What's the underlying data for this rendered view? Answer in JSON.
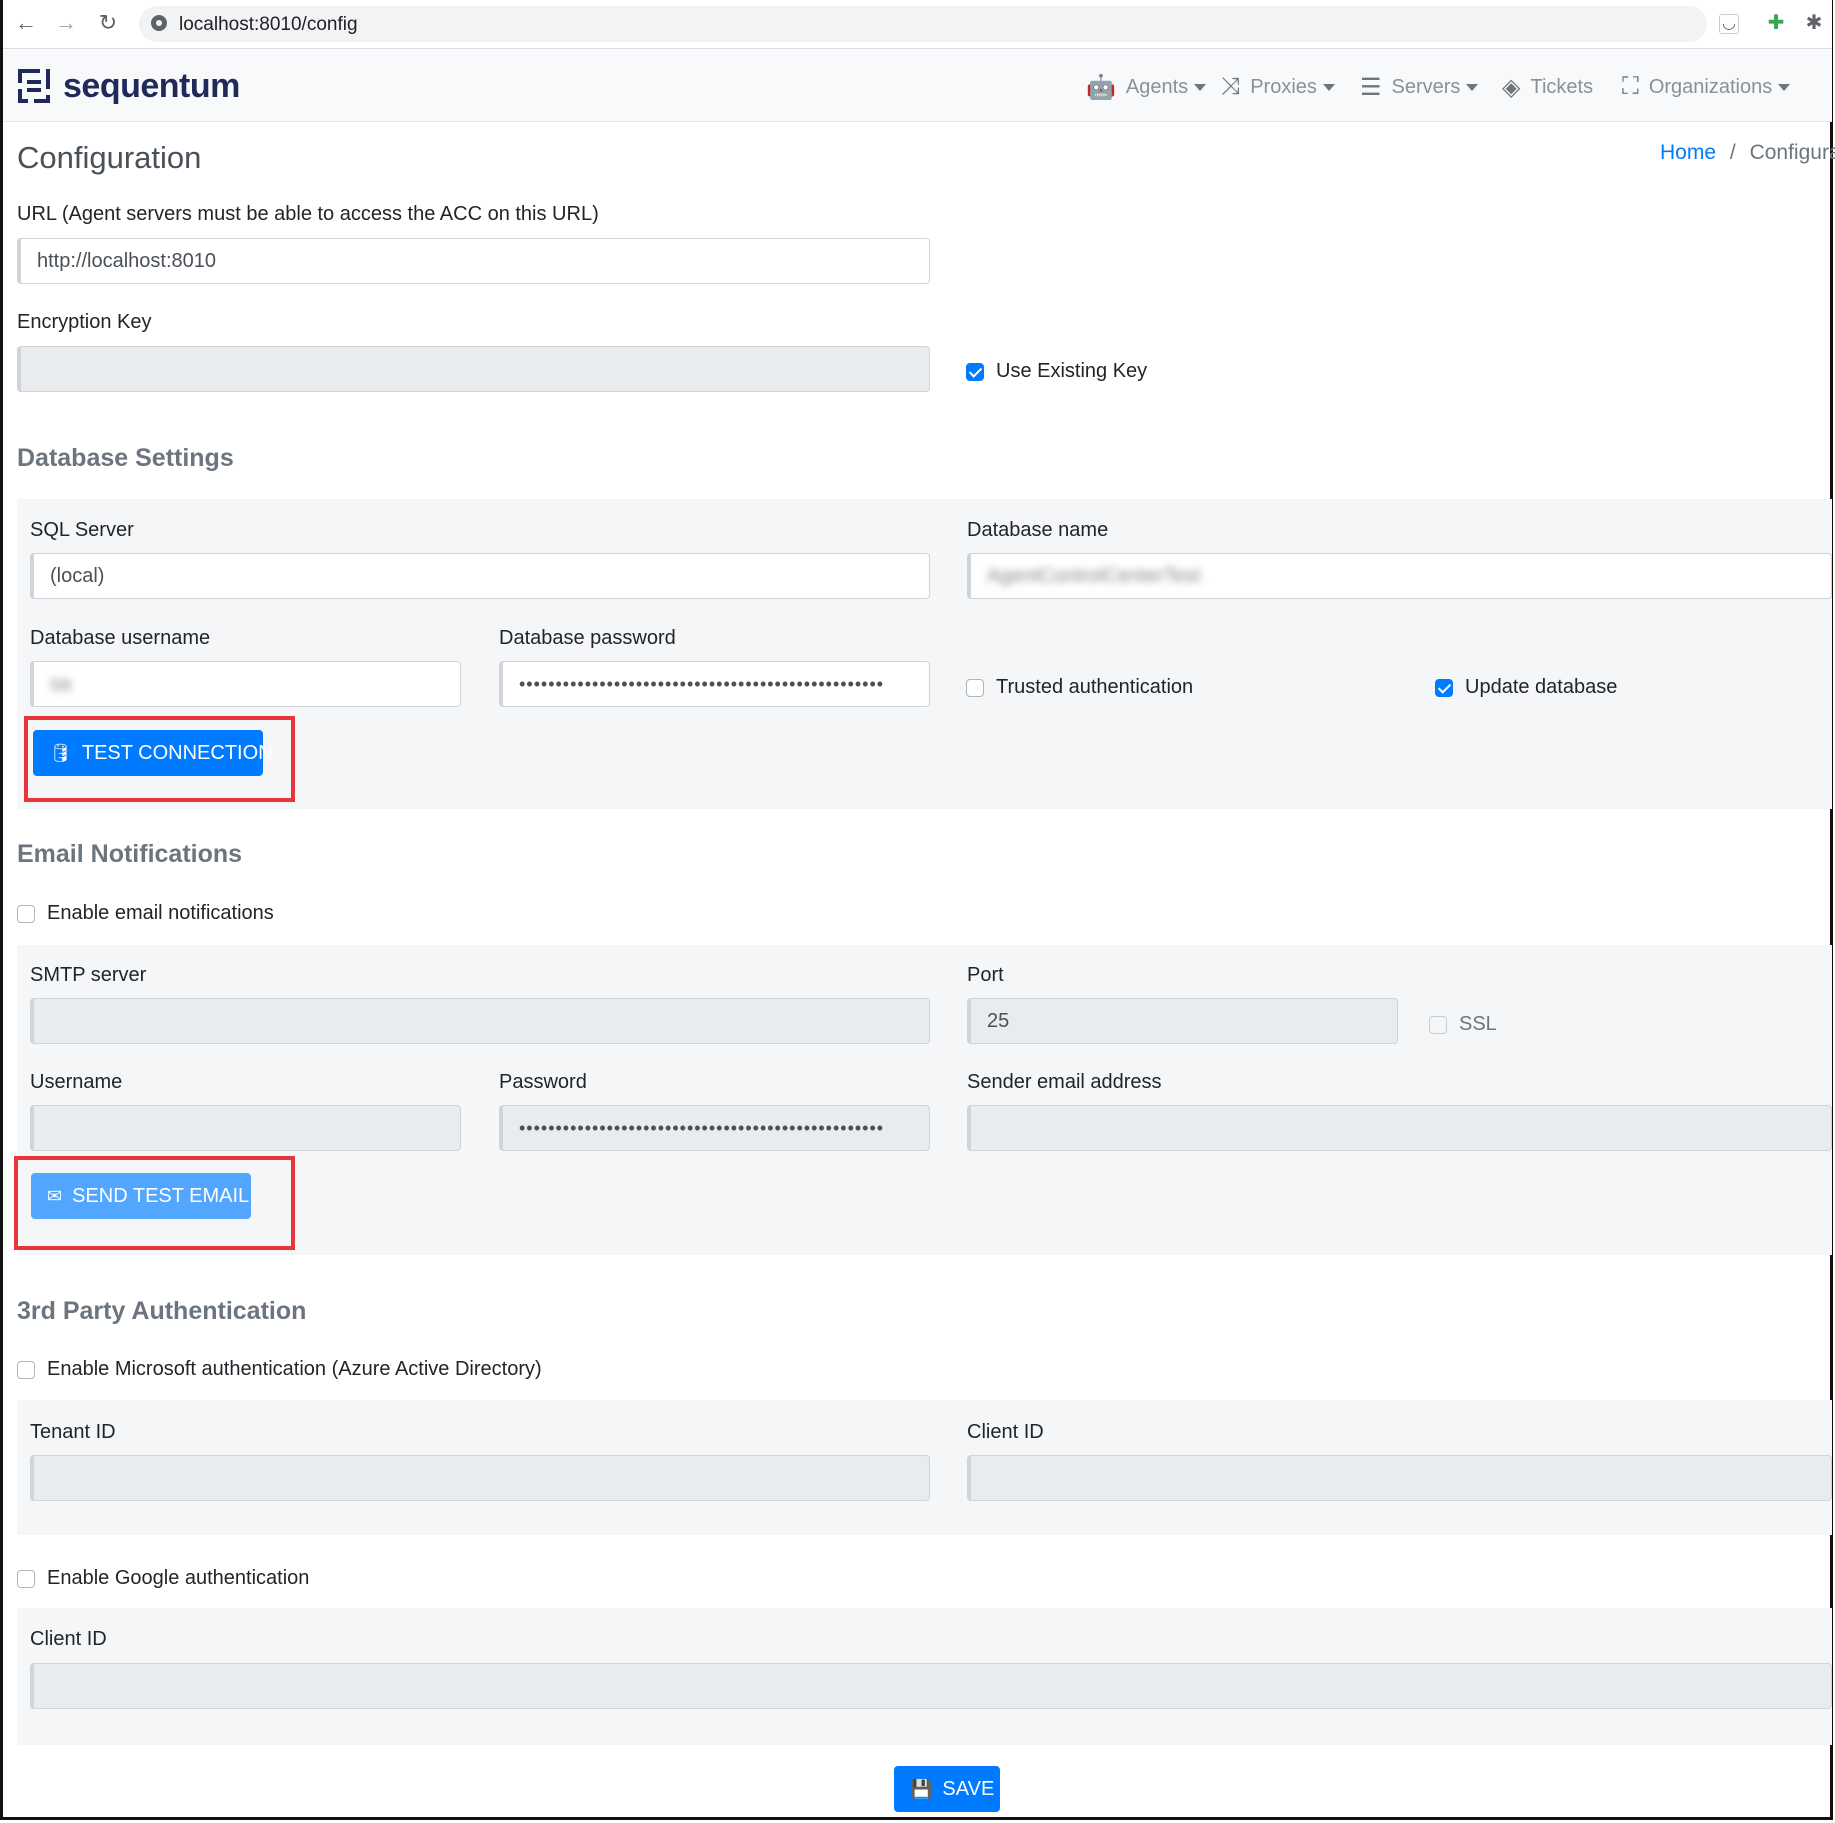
{
  "browser": {
    "url": "localhost:8010/config"
  },
  "brand": {
    "name": "sequentum"
  },
  "nav": {
    "agents": "Agents",
    "proxies": "Proxies",
    "servers": "Servers",
    "tickets": "Tickets",
    "organizations": "Organizations"
  },
  "page": {
    "title": "Configuration",
    "breadcrumb_home": "Home",
    "breadcrumb_sep": "/",
    "breadcrumb_current": "Configurat"
  },
  "general": {
    "url_label": "URL (Agent servers must be able to access the ACC on this URL)",
    "url_value": "http://localhost:8010",
    "key_label": "Encryption Key",
    "key_value": "",
    "use_existing_key": "Use Existing Key"
  },
  "database": {
    "heading": "Database Settings",
    "sql_server_label": "SQL Server",
    "sql_server_value": "(local)",
    "db_name_label": "Database name",
    "db_name_value": "AgentControlCenterTest",
    "username_label": "Database username",
    "username_value": "sa",
    "password_label": "Database password",
    "password_value": "••••••••••••••••••••••••••••••••••••••••••••••••••",
    "trusted_auth": "Trusted authentication",
    "update_db": "Update database",
    "test_button": "TEST CONNECTION"
  },
  "email": {
    "heading": "Email Notifications",
    "enable": "Enable email notifications",
    "smtp_label": "SMTP server",
    "port_label": "Port",
    "port_value": "25",
    "ssl": "SSL",
    "username_label": "Username",
    "password_label": "Password",
    "password_value": "••••••••••••••••••••••••••••••••••••••••••••••••••",
    "sender_label": "Sender email address",
    "test_button": "SEND TEST EMAIL"
  },
  "auth": {
    "heading": "3rd Party Authentication",
    "ms_enable": "Enable Microsoft authentication (Azure Active Directory)",
    "tenant_label": "Tenant ID",
    "client_label": "Client ID",
    "google_enable": "Enable Google authentication",
    "google_client_label": "Client ID"
  },
  "save_button": "SAVE",
  "colors": {
    "primary": "#007bff",
    "highlight": "#e8343b",
    "brand": "#1f2a5a"
  }
}
